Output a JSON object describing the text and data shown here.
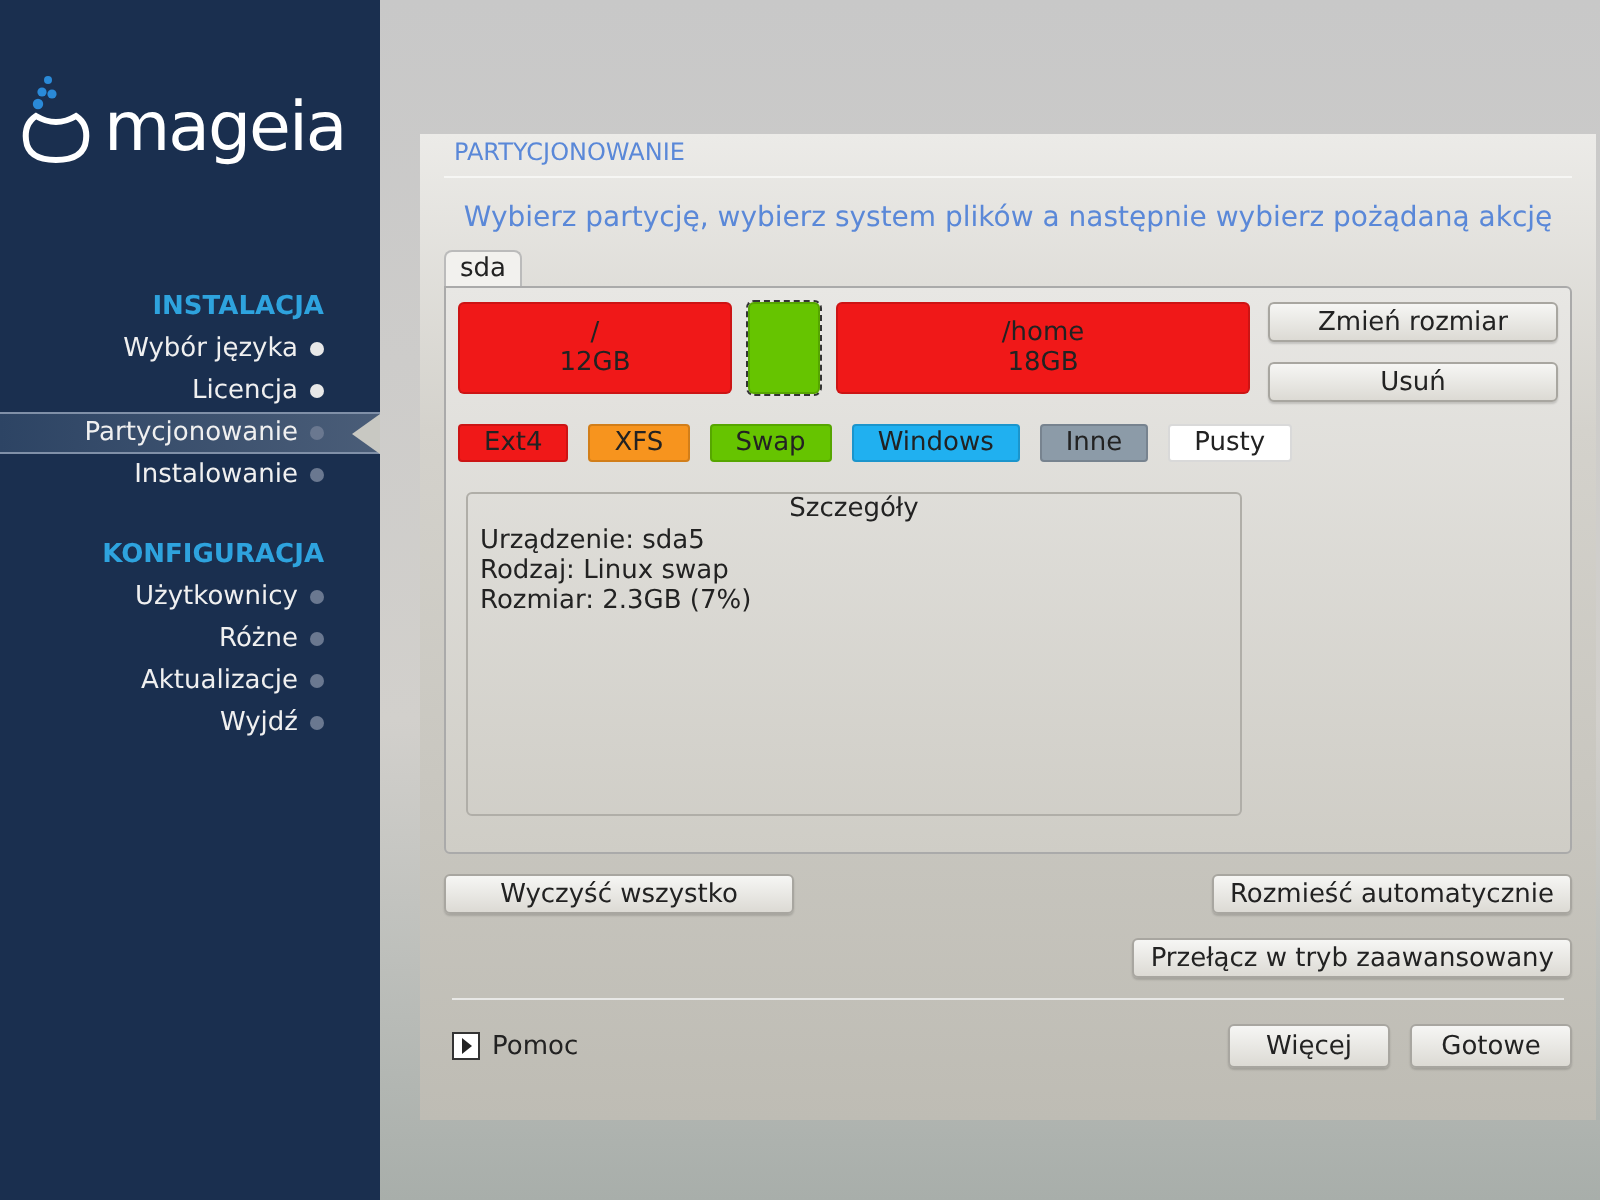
{
  "logo": {
    "text": "mageia"
  },
  "sidebar": {
    "sections": [
      {
        "title": "INSTALACJA",
        "items": [
          {
            "label": "Wybór języka",
            "selected": false,
            "done": true
          },
          {
            "label": "Licencja",
            "selected": false,
            "done": true
          },
          {
            "label": "Partycjonowanie",
            "selected": true,
            "done": false
          },
          {
            "label": "Instalowanie",
            "selected": false,
            "done": false
          }
        ]
      },
      {
        "title": "KONFIGURACJA",
        "items": [
          {
            "label": "Użytkownicy",
            "selected": false,
            "done": false
          },
          {
            "label": "Różne",
            "selected": false,
            "done": false
          },
          {
            "label": "Aktualizacje",
            "selected": false,
            "done": false
          },
          {
            "label": "Wyjdź",
            "selected": false,
            "done": false
          }
        ]
      }
    ]
  },
  "page": {
    "title": "PARTYCJONOWANIE",
    "subtitle": "Wybierz partycję, wybierz system plików a następnie wybierz pożądaną akcję"
  },
  "tabs": [
    {
      "label": "sda",
      "selected": true
    }
  ],
  "partitions": [
    {
      "mount": "/",
      "size": "12GB",
      "color": "#f01818",
      "selected": false
    },
    {
      "color": "#66c400",
      "selected": true
    },
    {
      "mount": "/home",
      "size": "18GB",
      "color": "#f01818",
      "selected": false
    }
  ],
  "partition_actions": [
    "Zmień rozmiar",
    "Usuń"
  ],
  "legend": [
    {
      "label": "Ext4",
      "color": "#f01818"
    },
    {
      "label": "XFS",
      "color": "#f7941e"
    },
    {
      "label": "Swap",
      "color": "#66c400"
    },
    {
      "label": "Windows",
      "color": "#20b0f0"
    },
    {
      "label": "Inne",
      "color": "#8c9ba8"
    },
    {
      "label": "Pusty",
      "color": "#ffffff"
    }
  ],
  "details": {
    "title": "Szczegóły",
    "lines": [
      "Urządzenie: sda5",
      "Rodzaj: Linux swap",
      "Rozmiar: 2.3GB (7%)"
    ]
  },
  "actions": {
    "clear": "Wyczyść wszystko",
    "auto": "Rozmieść automatycznie",
    "advanced": "Przełącz w tryb zaawansowany"
  },
  "help": {
    "label": "Pomoc",
    "expanded": false
  },
  "buttons": [
    "Więcej",
    "Gotowe"
  ]
}
